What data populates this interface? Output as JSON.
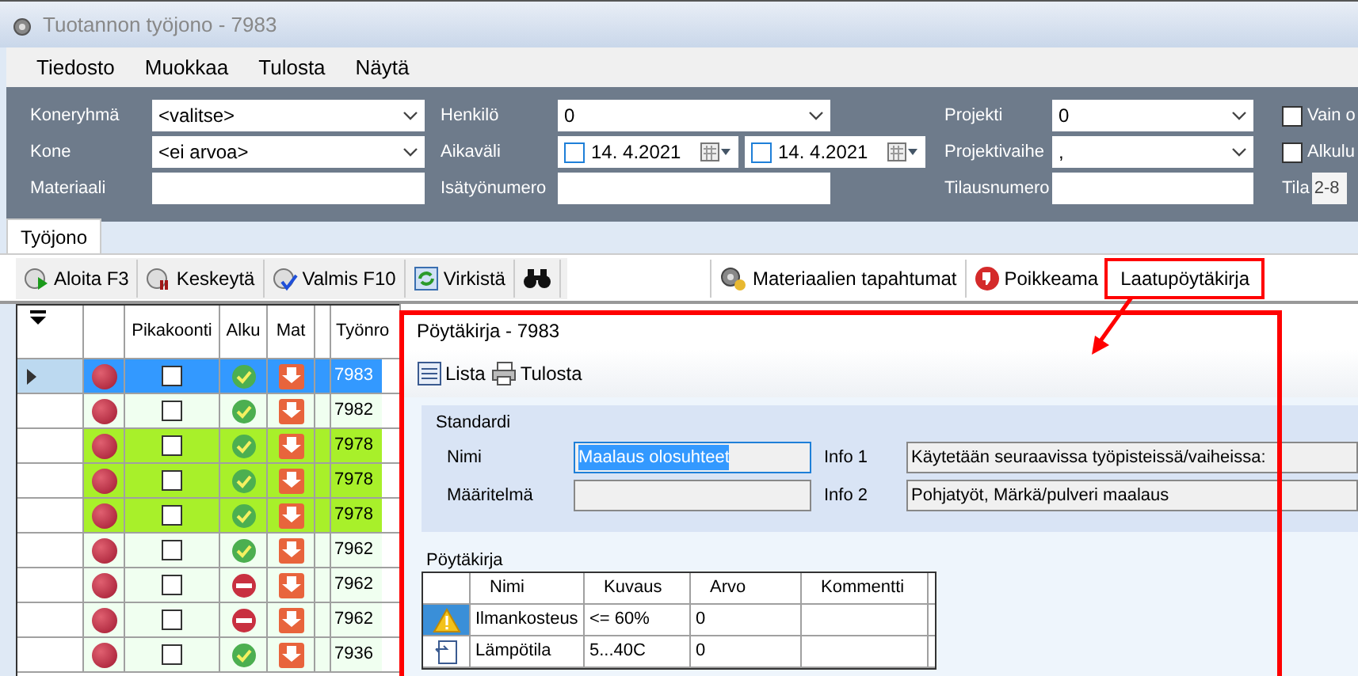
{
  "window": {
    "title": "Tuotannon työjono - 7983"
  },
  "menu": [
    "Tiedosto",
    "Muokkaa",
    "Tulosta",
    "Näytä"
  ],
  "filters": {
    "columns": [
      [
        {
          "kind": "combo",
          "label": "Koneryhmä",
          "value": "<valitse>"
        },
        {
          "kind": "combo",
          "label": "Kone",
          "value": "<ei arvoa>"
        },
        {
          "kind": "text",
          "label": "Materiaali"
        }
      ],
      [
        {
          "kind": "combo",
          "label": "Henkilö",
          "value": "0"
        },
        {
          "kind": "daterange",
          "label": "Aikaväli",
          "from": {
            "checked": false,
            "value": "14.  4.2021"
          },
          "to": {
            "checked": false,
            "value": "14.  4.2021"
          }
        },
        {
          "kind": "text",
          "label": "Isätyönumero"
        }
      ],
      [
        {
          "kind": "combo",
          "label": "Projekti",
          "value": "0"
        },
        {
          "kind": "combo",
          "label": "Projektivaihe",
          "value": ","
        },
        {
          "kind": "text",
          "label": "Tilausnumero"
        }
      ]
    ],
    "options": [
      {
        "label": "Vain o",
        "checked": false
      },
      {
        "label": "Alkulu",
        "checked": false
      }
    ],
    "tila": {
      "label": "Tila",
      "value": "2-8"
    }
  },
  "tabs": [
    {
      "label": "Työjono",
      "selected": true
    }
  ],
  "toolbar": [
    {
      "kind": "start",
      "label": "Aloita F3",
      "highlighted": false
    },
    {
      "kind": "pause",
      "label": "Keskeytä",
      "highlighted": false
    },
    {
      "kind": "done",
      "label": "Valmis F10",
      "highlighted": false
    },
    {
      "kind": "refresh",
      "label": "Virkistä",
      "highlighted": false
    },
    {
      "kind": "find",
      "highlighted": false
    }
  ],
  "toolbar_right": [
    {
      "kind": "materials",
      "label": "Materiaalien tapahtumat",
      "highlighted": false
    },
    {
      "kind": "thumb",
      "label": "Poikkeama",
      "highlighted": false
    },
    {
      "label": "Laatupöytäkirja",
      "highlighted": true
    }
  ],
  "grid": {
    "columns": [
      "Pikakoonti",
      "Alku",
      "Mat",
      "Työnro"
    ],
    "rows": [
      {
        "selected": true,
        "highlighted": false,
        "pikakoonti": false,
        "alku": {
          "kind": "ok"
        },
        "number": "7983"
      },
      {
        "selected": false,
        "highlighted": false,
        "pikakoonti": false,
        "alku": {
          "kind": "ok"
        },
        "number": "7982"
      },
      {
        "selected": false,
        "highlighted": true,
        "pikakoonti": false,
        "alku": {
          "kind": "ok"
        },
        "number": "7978"
      },
      {
        "selected": false,
        "highlighted": true,
        "pikakoonti": false,
        "alku": {
          "kind": "ok"
        },
        "number": "7978"
      },
      {
        "selected": false,
        "highlighted": true,
        "pikakoonti": false,
        "alku": {
          "kind": "ok"
        },
        "number": "7978"
      },
      {
        "selected": false,
        "highlighted": false,
        "pikakoonti": false,
        "alku": {
          "kind": "ok"
        },
        "number": "7962"
      },
      {
        "selected": false,
        "highlighted": false,
        "pikakoonti": false,
        "alku": {
          "kind": "stop"
        },
        "number": "7962"
      },
      {
        "selected": false,
        "highlighted": false,
        "pikakoonti": false,
        "alku": {
          "kind": "stop"
        },
        "number": "7962"
      },
      {
        "selected": false,
        "highlighted": false,
        "pikakoonti": false,
        "alku": {
          "kind": "ok"
        },
        "number": "7936"
      }
    ]
  },
  "dialog": {
    "title": "Pöytäkirja - 7983",
    "toolbar": [
      {
        "kind": "list",
        "label": "Lista"
      },
      {
        "kind": "print",
        "label": "Tulosta"
      }
    ],
    "standard": {
      "title": "Standardi",
      "fields": [
        {
          "label": "Nimi",
          "value": "Maalaus olosuhteet",
          "selected": true
        },
        {
          "label": "Info 1",
          "value": "Käytetään seuraavissa työpisteissä/vaiheissa:",
          "selected": false
        },
        {
          "label": "Määritelmä",
          "selected": false
        },
        {
          "label": "Info 2",
          "value": "Pohjatyöt, Märkä/pulveri maalaus",
          "selected": false
        }
      ]
    },
    "protocol": {
      "title": "Pöytäkirja",
      "columns": [
        "Nimi",
        "Kuvaus",
        "Arvo",
        "Kommentti"
      ],
      "rows": [
        {
          "kind": "warning",
          "name": "Ilmankosteus",
          "description": "<= 60%",
          "value": "0"
        },
        {
          "kind": "document",
          "name": "Lämpötila",
          "description": "5...40C",
          "value": "0"
        }
      ]
    }
  }
}
